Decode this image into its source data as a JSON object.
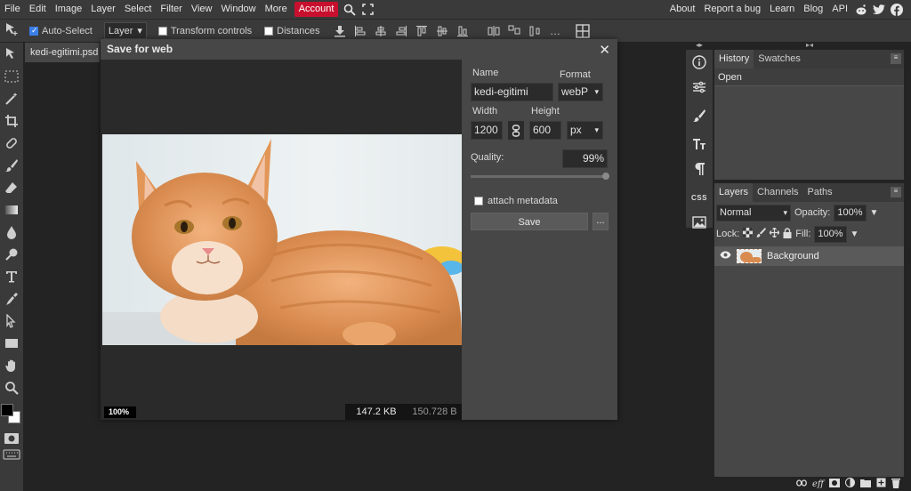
{
  "menu": {
    "items": [
      "File",
      "Edit",
      "Image",
      "Layer",
      "Select",
      "Filter",
      "View",
      "Window",
      "More"
    ],
    "account": "Account",
    "right_links": [
      "About",
      "Report a bug",
      "Learn",
      "Blog",
      "API"
    ]
  },
  "options": {
    "auto_select": "Auto-Select",
    "layer_select": "Layer",
    "transform_controls": "Transform controls",
    "distances": "Distances"
  },
  "document": {
    "tab_name": "kedi-egitimi.psd"
  },
  "dialog": {
    "title": "Save for web",
    "name_label": "Name",
    "name_value": "kedi-egitimi",
    "format_label": "Format",
    "format_value": "webP",
    "width_label": "Width",
    "width_value": "1200",
    "height_label": "Height",
    "height_value": "600",
    "unit_value": "px",
    "quality_label": "Quality:",
    "quality_value": "99%",
    "quality_level": 0.99,
    "metadata_label": "attach metadata",
    "save_label": "Save",
    "more_label": "...",
    "zoom": "100%",
    "size_kb": "147.2 KB",
    "size_bytes": "150.728 B"
  },
  "history_panel": {
    "tabs": [
      "History",
      "Swatches"
    ],
    "entries": [
      "Open"
    ]
  },
  "layers_panel": {
    "tabs": [
      "Layers",
      "Channels",
      "Paths"
    ],
    "blend_mode": "Normal",
    "opacity_label": "Opacity:",
    "opacity_value": "100%",
    "lock_label": "Lock:",
    "fill_label": "Fill:",
    "fill_value": "100%",
    "layers": [
      {
        "name": "Background"
      }
    ]
  },
  "colors": {
    "accent": "#c8102e",
    "foreground": "#000000",
    "background": "#ffffff"
  }
}
